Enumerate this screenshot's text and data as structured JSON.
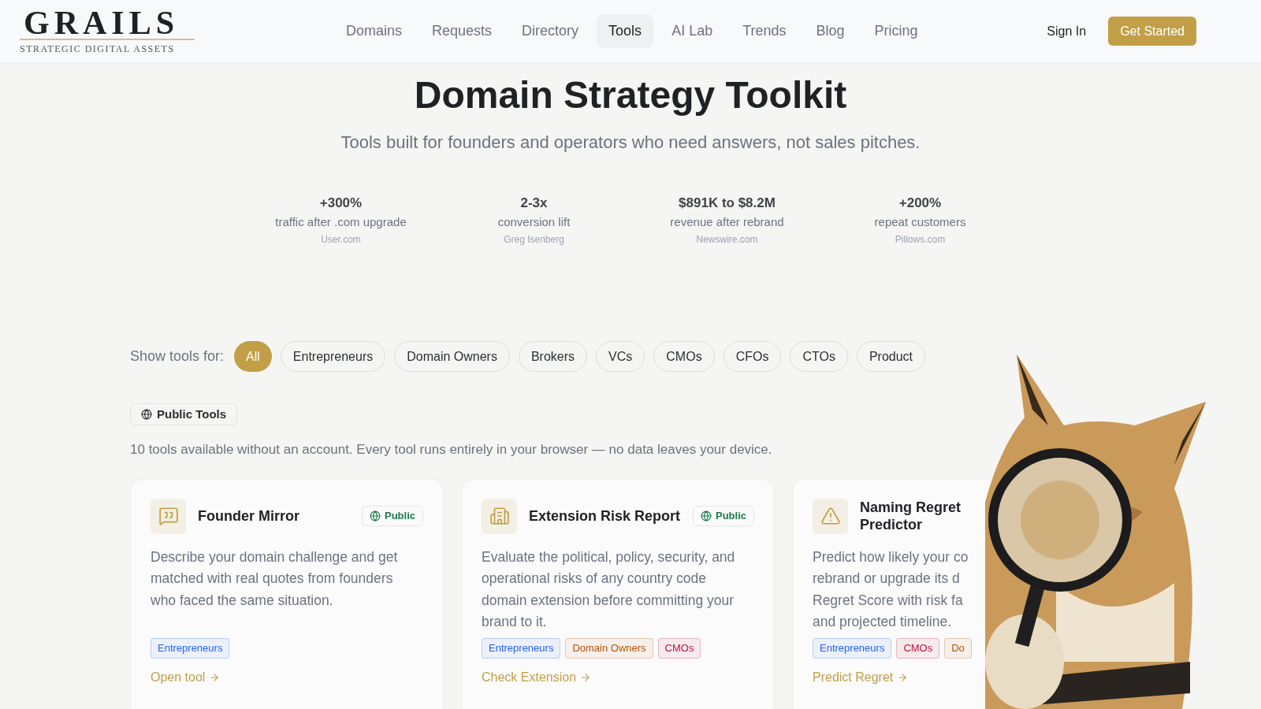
{
  "header": {
    "logo": {
      "wordmark": "GRAILS",
      "tagline": "STRATEGIC DIGITAL ASSETS"
    },
    "nav": [
      {
        "label": "Domains",
        "selected": false
      },
      {
        "label": "Requests",
        "selected": false
      },
      {
        "label": "Directory",
        "selected": false
      },
      {
        "label": "Tools",
        "selected": true
      },
      {
        "label": "AI Lab",
        "selected": false
      },
      {
        "label": "Trends",
        "selected": false
      },
      {
        "label": "Blog",
        "selected": false
      },
      {
        "label": "Pricing",
        "selected": false
      }
    ],
    "sign_in": "Sign In",
    "cta": "Get Started"
  },
  "hero": {
    "title": "Domain Strategy Toolkit",
    "subtitle": "Tools built for founders and operators who need answers, not sales pitches.",
    "stats": [
      {
        "value": "+300%",
        "label": "traffic after .com upgrade",
        "source": "User.com"
      },
      {
        "value": "2-3x",
        "label": "conversion lift",
        "source": "Greg Isenberg"
      },
      {
        "value": "$891K to $8.2M",
        "label": "revenue after rebrand",
        "source": "Newswire.com"
      },
      {
        "value": "+200%",
        "label": "repeat customers",
        "source": "Pillows.com"
      }
    ]
  },
  "filter": {
    "label": "Show tools for:",
    "options": [
      {
        "label": "All",
        "selected": true
      },
      {
        "label": "Entrepreneurs",
        "selected": false
      },
      {
        "label": "Domain Owners",
        "selected": false
      },
      {
        "label": "Brokers",
        "selected": false
      },
      {
        "label": "VCs",
        "selected": false
      },
      {
        "label": "CMOs",
        "selected": false
      },
      {
        "label": "CFOs",
        "selected": false
      },
      {
        "label": "CTOs",
        "selected": false
      },
      {
        "label": "Product",
        "selected": false
      }
    ]
  },
  "section": {
    "badge": "Public Tools",
    "note": "10 tools available without an account. Every tool runs entirely in your browser — no data leaves your device."
  },
  "cards": [
    {
      "title": "Founder Mirror",
      "badge": "Public",
      "description_lines": [
        "Describe your domain challenge and get",
        "matched with real quotes from founders",
        "who faced the same situation."
      ],
      "tags": [
        {
          "label": "Entrepreneurs",
          "color": "#2563eb"
        }
      ],
      "link": "Open tool"
    },
    {
      "title": "Extension Risk Report",
      "badge": "Public",
      "description_lines": [
        "Evaluate the political, policy, security, and",
        "operational risks of any country code",
        "domain extension before committing your",
        "brand to it."
      ],
      "tags": [
        {
          "label": "Entrepreneurs",
          "color": "#2563eb"
        },
        {
          "label": "Domain Owners",
          "color": "#b45309"
        },
        {
          "label": "CMOs",
          "color": "#be123c"
        }
      ],
      "link": "Check Extension"
    },
    {
      "title": "Naming Regret Predictor",
      "description_lines": [
        "Predict how likely your co",
        "rebrand or upgrade its d",
        "Regret Score with risk fa",
        "and projected timeline."
      ],
      "tags": [
        {
          "label": "Entrepreneurs",
          "color": "#2563eb"
        },
        {
          "label": "CMOs",
          "color": "#be123c"
        },
        {
          "label": "Do",
          "color": "#b45309"
        }
      ],
      "link": "Predict Regret"
    }
  ]
}
